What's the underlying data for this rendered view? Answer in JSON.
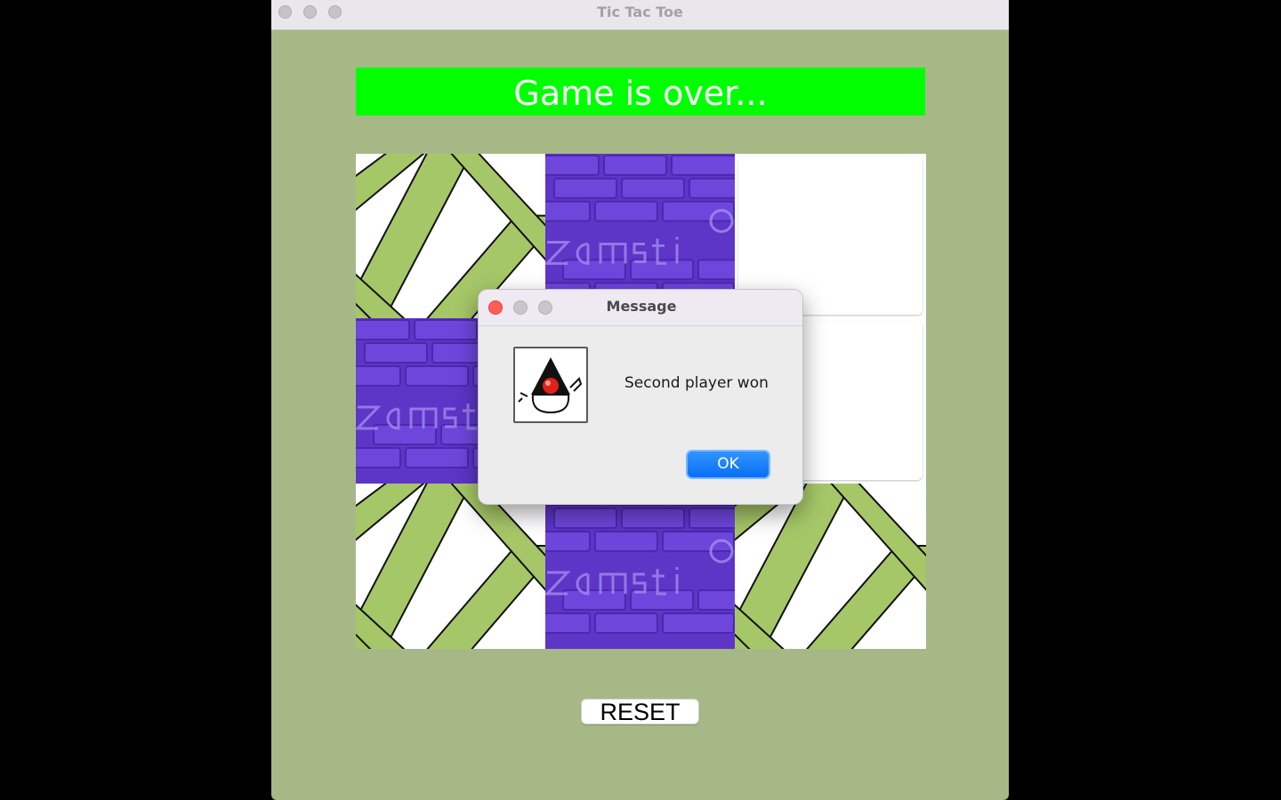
{
  "window": {
    "title": "Tic Tac Toe",
    "background": "#a7b887"
  },
  "banner": {
    "text": "Game is over...",
    "background": "#00ff00"
  },
  "board": {
    "cells": [
      {
        "state": "green-lattice"
      },
      {
        "state": "purple-brick"
      },
      {
        "state": "empty"
      },
      {
        "state": "purple-brick"
      },
      {
        "state": "hidden"
      },
      {
        "state": "empty"
      },
      {
        "state": "green-lattice"
      },
      {
        "state": "purple-brick"
      },
      {
        "state": "green-lattice"
      }
    ]
  },
  "reset_button": {
    "label": "RESET"
  },
  "dialog": {
    "title": "Message",
    "icon": "java-duke-icon",
    "message": "Second player won",
    "ok_label": "OK"
  }
}
